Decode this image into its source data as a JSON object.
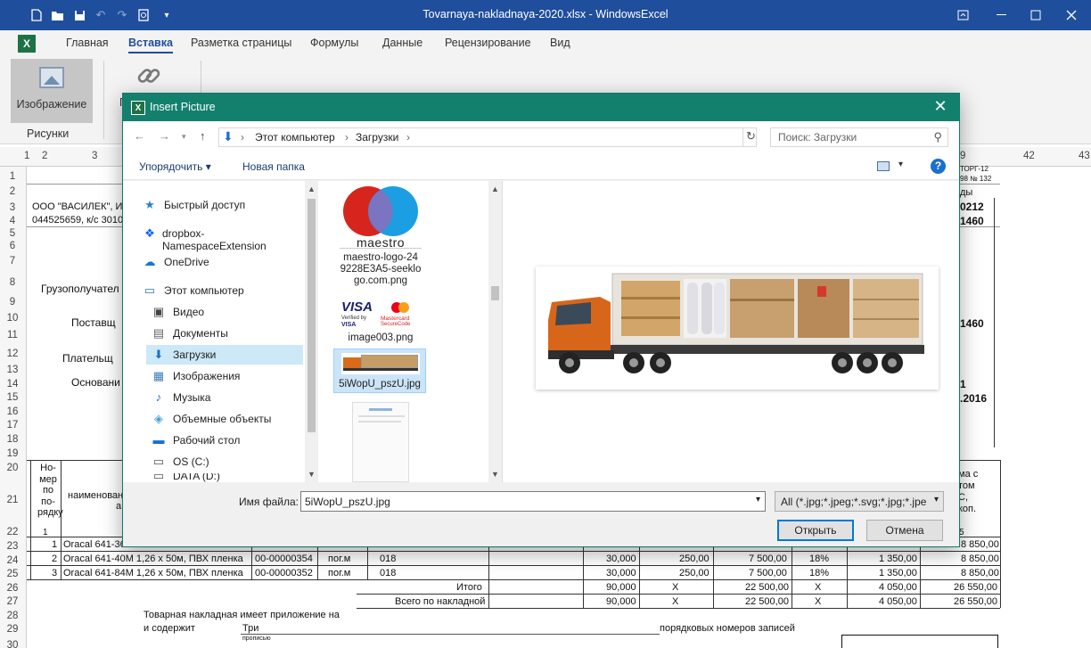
{
  "window": {
    "title": "Tovarnaya-nakladnaya-2020.xlsx - WindowsExcel"
  },
  "colors": {
    "titlebar": "#1f4e9c",
    "dialog_title": "#13806e",
    "excel_green": "#1e7145"
  },
  "icons": [
    "new-icon",
    "open-icon",
    "save-icon",
    "undo-icon",
    "redo-icon",
    "print-preview-icon",
    "customize-icon",
    "ribbon-display-icon",
    "minimize-icon",
    "maximize-icon",
    "close-icon"
  ],
  "ribbon": {
    "logo": "X",
    "tabs": [
      "Главная",
      "Вставка",
      "Разметка страницы",
      "Формулы",
      "Данные",
      "Рецензирование",
      "Вид"
    ],
    "active_tab": "Вставка",
    "image_button": "Изображение",
    "link_button_partial": "Г",
    "group_label": "Рисунки"
  },
  "sheet": {
    "col_headers": [
      "1",
      "2",
      "3",
      "9",
      "42",
      "43"
    ],
    "row_headers": [
      "1",
      "2",
      "3",
      "4",
      "5",
      "6",
      "7",
      "8",
      "9",
      "10",
      "11",
      "12",
      "13",
      "14",
      "15",
      "16",
      "17",
      "18",
      "19",
      "20",
      "21",
      "22",
      "23",
      "24",
      "25",
      "26",
      "27",
      "28",
      "29",
      "30"
    ],
    "left_texts": {
      "company": "ООО \"ВАСИЛЕК\", И",
      "account": "044525659, к/с 3010",
      "consignee": "Грузополучател",
      "supplier": "Поставщ",
      "payer": "Плательщ",
      "basis": "Основани",
      "num_header": [
        "Но-",
        "мер",
        "по",
        "по-",
        "рядку"
      ],
      "name_header": "наименован",
      "name_header_a": "а",
      "col_one": "1"
    },
    "right_texts": {
      "torg": "ТОРГ-12",
      "torg_sub": "98 № 132",
      "codes": "ды",
      "r3": "0212",
      "r4": "1460",
      "r10": "1460",
      "r14": "1",
      "r15": ".2016",
      "sum_header": [
        "ма с",
        "том",
        "С,",
        "коп."
      ],
      "col_num": "5"
    },
    "rows": [
      {
        "n": "1",
        "name": "Oracal 641-36",
        "code": "",
        "unit": "",
        "okei": "",
        "qty": "",
        "price": "",
        "sum": "",
        "vat": "",
        "vat_sum": "",
        "total": "8 850,00"
      },
      {
        "n": "2",
        "name": "Oracal 641-40M 1,26 x 50м, ПВХ пленка",
        "code": "00-00000354",
        "unit": "пог.м",
        "okei": "018",
        "qty": "30,000",
        "price": "250,00",
        "sum": "7 500,00",
        "vat": "18%",
        "vat_sum": "1 350,00",
        "total": "8 850,00"
      },
      {
        "n": "3",
        "name": "Oracal 641-84M 1,26 x 50м, ПВХ пленка",
        "code": "00-00000352",
        "unit": "пог.м",
        "okei": "018",
        "qty": "30,000",
        "price": "250,00",
        "sum": "7 500,00",
        "vat": "18%",
        "vat_sum": "1 350,00",
        "total": "8 850,00"
      }
    ],
    "totals": [
      {
        "label": "Итого",
        "qty": "90,000",
        "x1": "X",
        "sum": "22 500,00",
        "x2": "X",
        "vat_sum": "4 050,00",
        "total": "26 550,00"
      },
      {
        "label": "Всего по накладной",
        "qty": "90,000",
        "x1": "X",
        "sum": "22 500,00",
        "x2": "X",
        "vat_sum": "4 050,00",
        "total": "26 550,00"
      }
    ],
    "footer": {
      "line1": "Товарная накладная имеет приложение на",
      "line2": "и содержит",
      "count": "Три",
      "propis": "прописью",
      "records": "порядковых номеров записей"
    }
  },
  "dialog": {
    "title": "Insert Picture",
    "logo": "X",
    "address": {
      "computer": "Этот компьютер",
      "folder": "Загрузки"
    },
    "search_placeholder": "Поиск: Загрузки",
    "toolbar": {
      "organize": "Упорядочить ▾",
      "new_folder": "Новая папка"
    },
    "nav_items": [
      {
        "label": "Быстрый доступ",
        "icon": "star-icon"
      },
      {
        "label": "dropbox-NamespaceExtension",
        "icon": "dropbox-icon"
      },
      {
        "label": "OneDrive",
        "icon": "cloud-icon"
      },
      {
        "label": "Этот компьютер",
        "icon": "computer-icon"
      },
      {
        "label": "Видео",
        "icon": "video-icon"
      },
      {
        "label": "Документы",
        "icon": "document-icon"
      },
      {
        "label": "Загрузки",
        "icon": "download-icon"
      },
      {
        "label": "Изображения",
        "icon": "pictures-icon"
      },
      {
        "label": "Музыка",
        "icon": "music-icon"
      },
      {
        "label": "Объемные объекты",
        "icon": "3d-objects-icon"
      },
      {
        "label": "Рабочий стол",
        "icon": "desktop-icon"
      },
      {
        "label": "OS (C:)",
        "icon": "drive-icon"
      },
      {
        "label": "DATA (D:)",
        "icon": "drive-icon"
      }
    ],
    "files": [
      {
        "name": "maestro-logo-249228E3A5-seeklogo.com.png",
        "lines": [
          "maestro-logo-24",
          "9228E3A5-seeklo",
          "go.com.png"
        ],
        "logo_text": "maestro"
      },
      {
        "name": "image003.png",
        "logo_visa": "VISA",
        "verified": "Verified by",
        "verified_visa": "VISA",
        "mc": "Mastercard",
        "mc2": "SecureCode"
      },
      {
        "name": "5iWopU_pszU.jpg"
      },
      {
        "name": ""
      }
    ],
    "file_name_label": "Имя файла:",
    "file_name_value": "5iWopU_pszU.jpg",
    "filter_value": "All (*.jpg;*.jpeg;*.svg;*.jpg;*.jpe",
    "open_button": "Открыть",
    "cancel_button": "Отмена"
  }
}
